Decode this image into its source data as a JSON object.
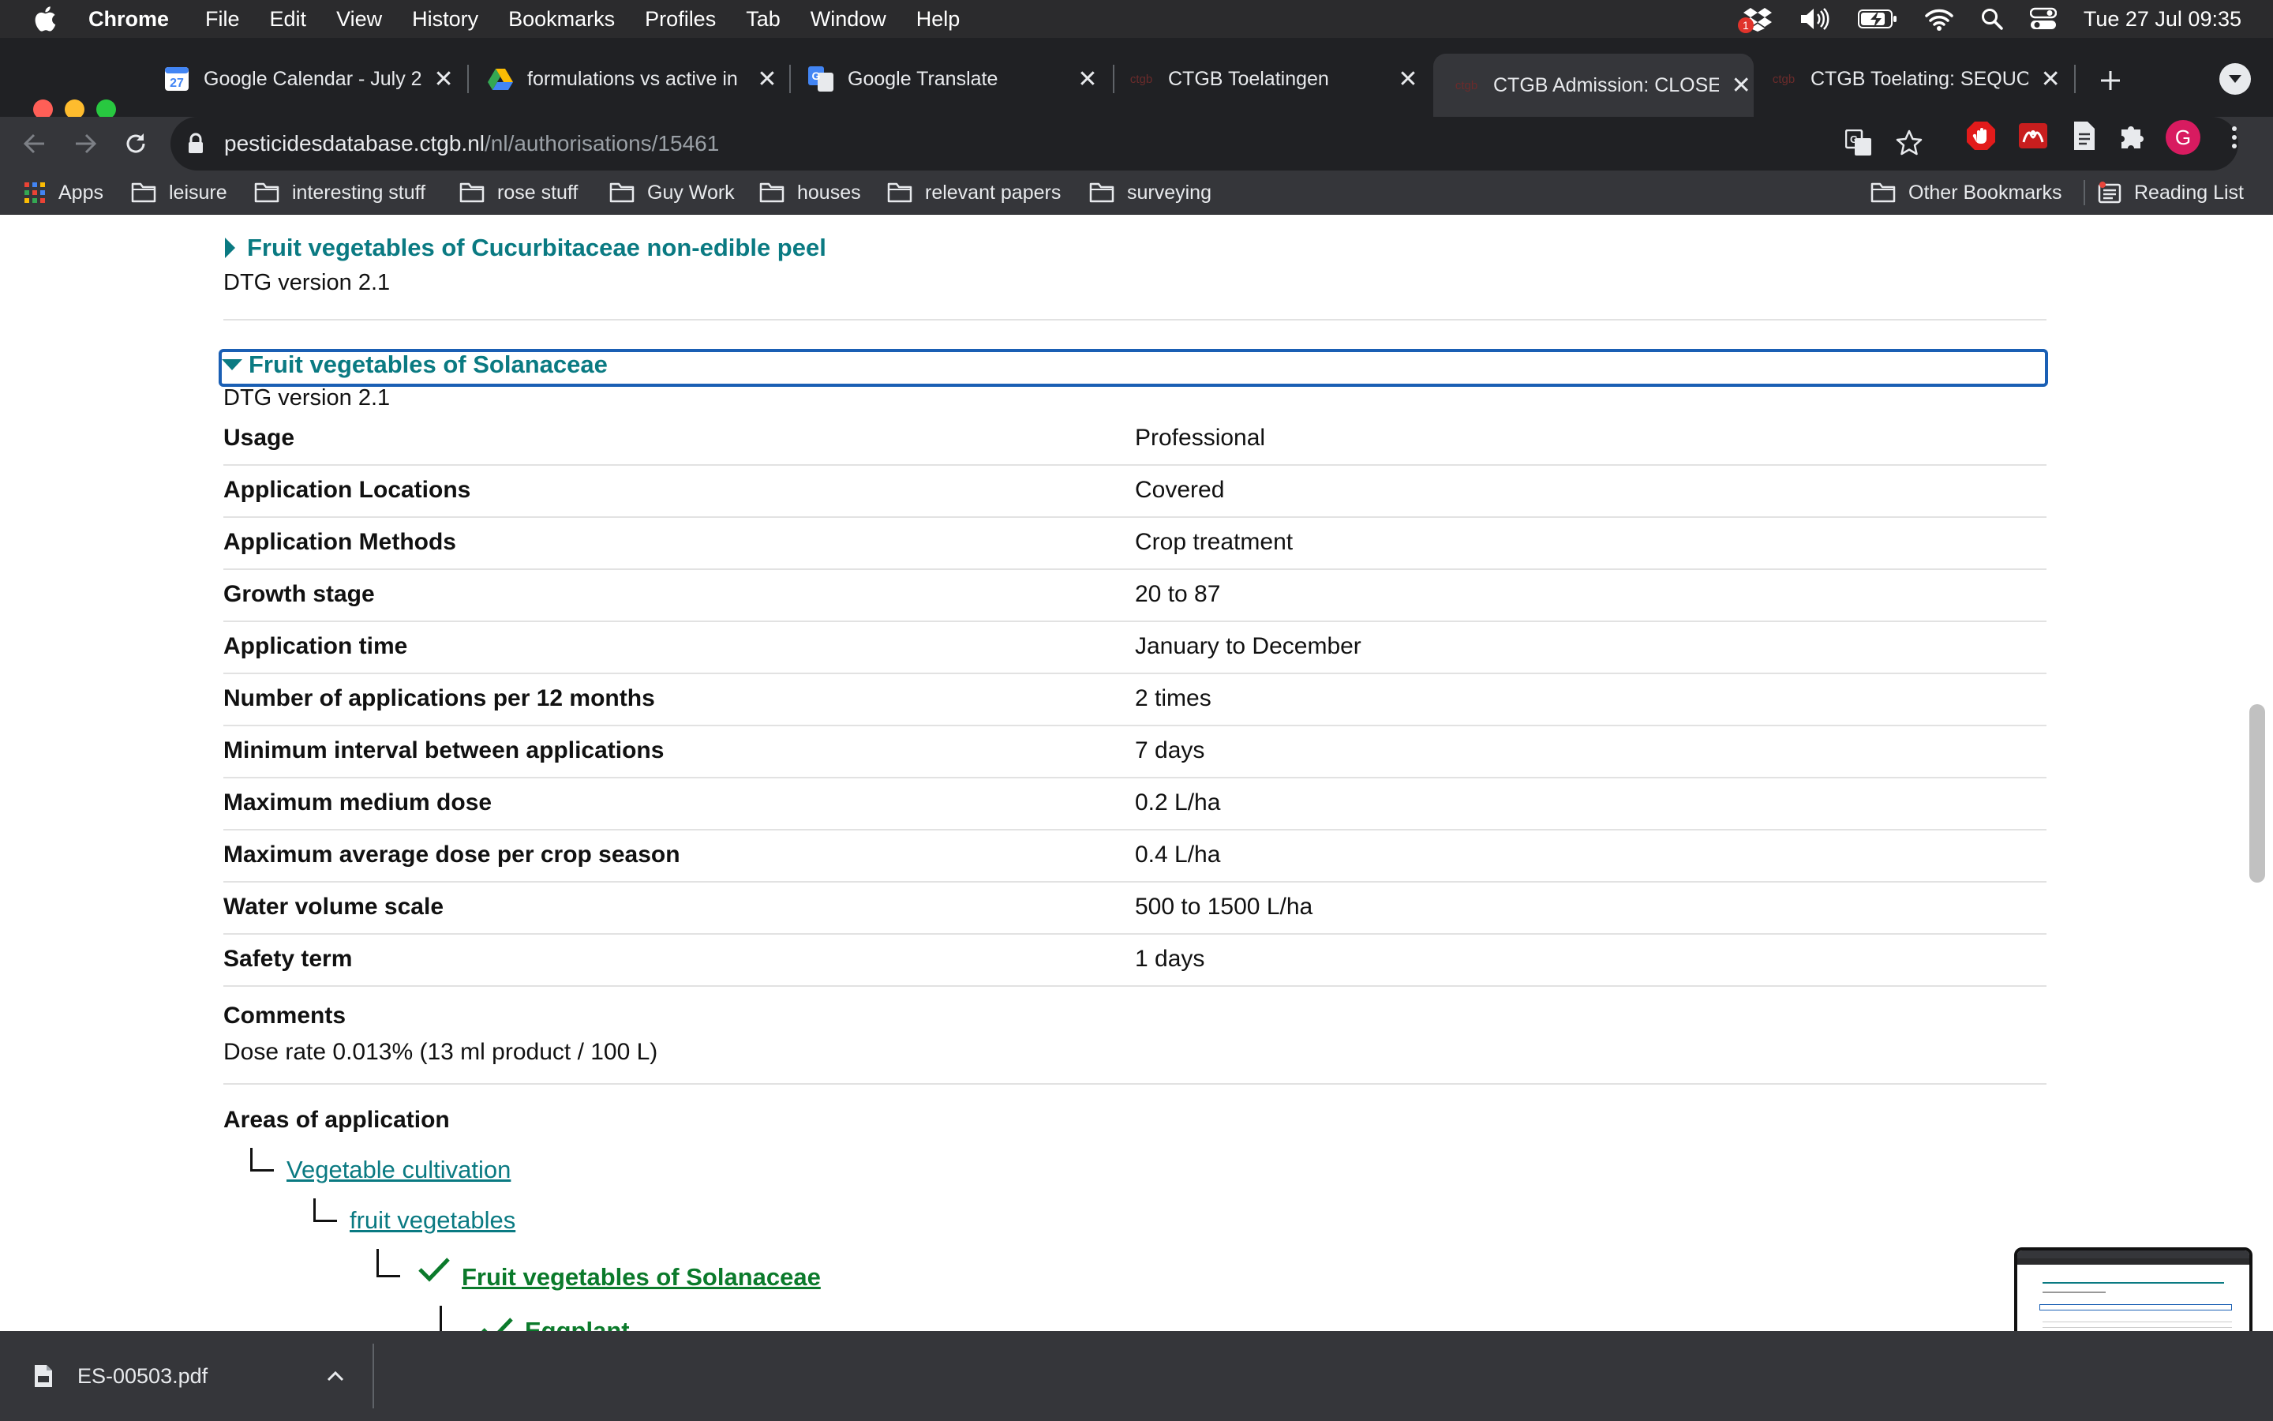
{
  "menubar": {
    "app_name": "Chrome",
    "items": [
      "File",
      "Edit",
      "View",
      "History",
      "Bookmarks",
      "Profiles",
      "Tab",
      "Window",
      "Help"
    ],
    "clock": "Tue 27 Jul  09:35",
    "badge_count": "1",
    "status_icons": [
      "dropbox-icon",
      "volume-icon",
      "battery-icon",
      "wifi-icon",
      "spotlight-search-icon",
      "control-center-icon"
    ]
  },
  "tabs": [
    {
      "title": "Google Calendar - July 2",
      "icon": "google-calendar-icon",
      "active": false
    },
    {
      "title": "formulations vs active in",
      "icon": "google-drive-icon",
      "active": false
    },
    {
      "title": "Google Translate",
      "icon": "google-translate-icon",
      "active": false
    },
    {
      "title": "CTGB Toelatingen",
      "icon": "ctgb-icon",
      "active": false
    },
    {
      "title": "CTGB Admission: CLOSE",
      "icon": "ctgb-icon",
      "active": true
    },
    {
      "title": "CTGB Toelating: SEQUO",
      "icon": "ctgb-icon",
      "active": false
    }
  ],
  "calendar_icon_day": "27",
  "favicon_text": "ctgb",
  "address": {
    "host": "pesticidesdatabase.ctgb.nl",
    "path": "/nl/authorisations/15461"
  },
  "profile_initial": "G",
  "bookmarks": {
    "apps_label": "Apps",
    "folders": [
      "leisure",
      "interesting stuff",
      "rose stuff",
      "Guy Work",
      "houses",
      "relevant papers",
      "surveying"
    ],
    "other": "Other Bookmarks",
    "reading_list": "Reading List"
  },
  "content": {
    "prev_section": {
      "title": "Fruit vegetables of Cucurbitaceae non-edible peel",
      "dtg": "DTG version 2.1"
    },
    "section": {
      "title": "Fruit vegetables of Solanaceae",
      "dtg": "DTG version 2.1",
      "rows": [
        {
          "label": "Usage",
          "value": "Professional"
        },
        {
          "label": "Application Locations",
          "value": "Covered"
        },
        {
          "label": "Application Methods",
          "value": "Crop treatment"
        },
        {
          "label": "Growth stage",
          "value": "20 to 87"
        },
        {
          "label": "Application time",
          "value": "January to December"
        },
        {
          "label": "Number of applications per 12 months",
          "value": "2 times"
        },
        {
          "label": "Minimum interval between applications",
          "value": "7 days"
        },
        {
          "label": "Maximum medium dose",
          "value": "0.2 L/ha"
        },
        {
          "label": "Maximum average dose per crop season",
          "value": "0.4 L/ha"
        },
        {
          "label": "Water volume scale",
          "value": "500 to 1500 L/ha"
        },
        {
          "label": "Safety term",
          "value": "1 days"
        }
      ],
      "comments_label": "Comments",
      "comments_value": "Dose rate 0.013% (13 ml product / 100 L)",
      "areas_label": "Areas of application",
      "tree": [
        {
          "label": "Vegetable cultivation",
          "checked": false
        },
        {
          "label": "fruit vegetables",
          "checked": false
        },
        {
          "label": "Fruit vegetables of Solanaceae",
          "checked": true
        },
        {
          "label": "Eggplant",
          "checked": true
        }
      ]
    }
  },
  "downloads": {
    "file": "ES-00503.pdf"
  },
  "colors": {
    "accent_teal": "#0a7a82",
    "check_green": "#0b7a2b",
    "focus_blue": "#1a5fb4",
    "chrome_dark": "#202124",
    "chrome_toolbar": "#35363a"
  }
}
